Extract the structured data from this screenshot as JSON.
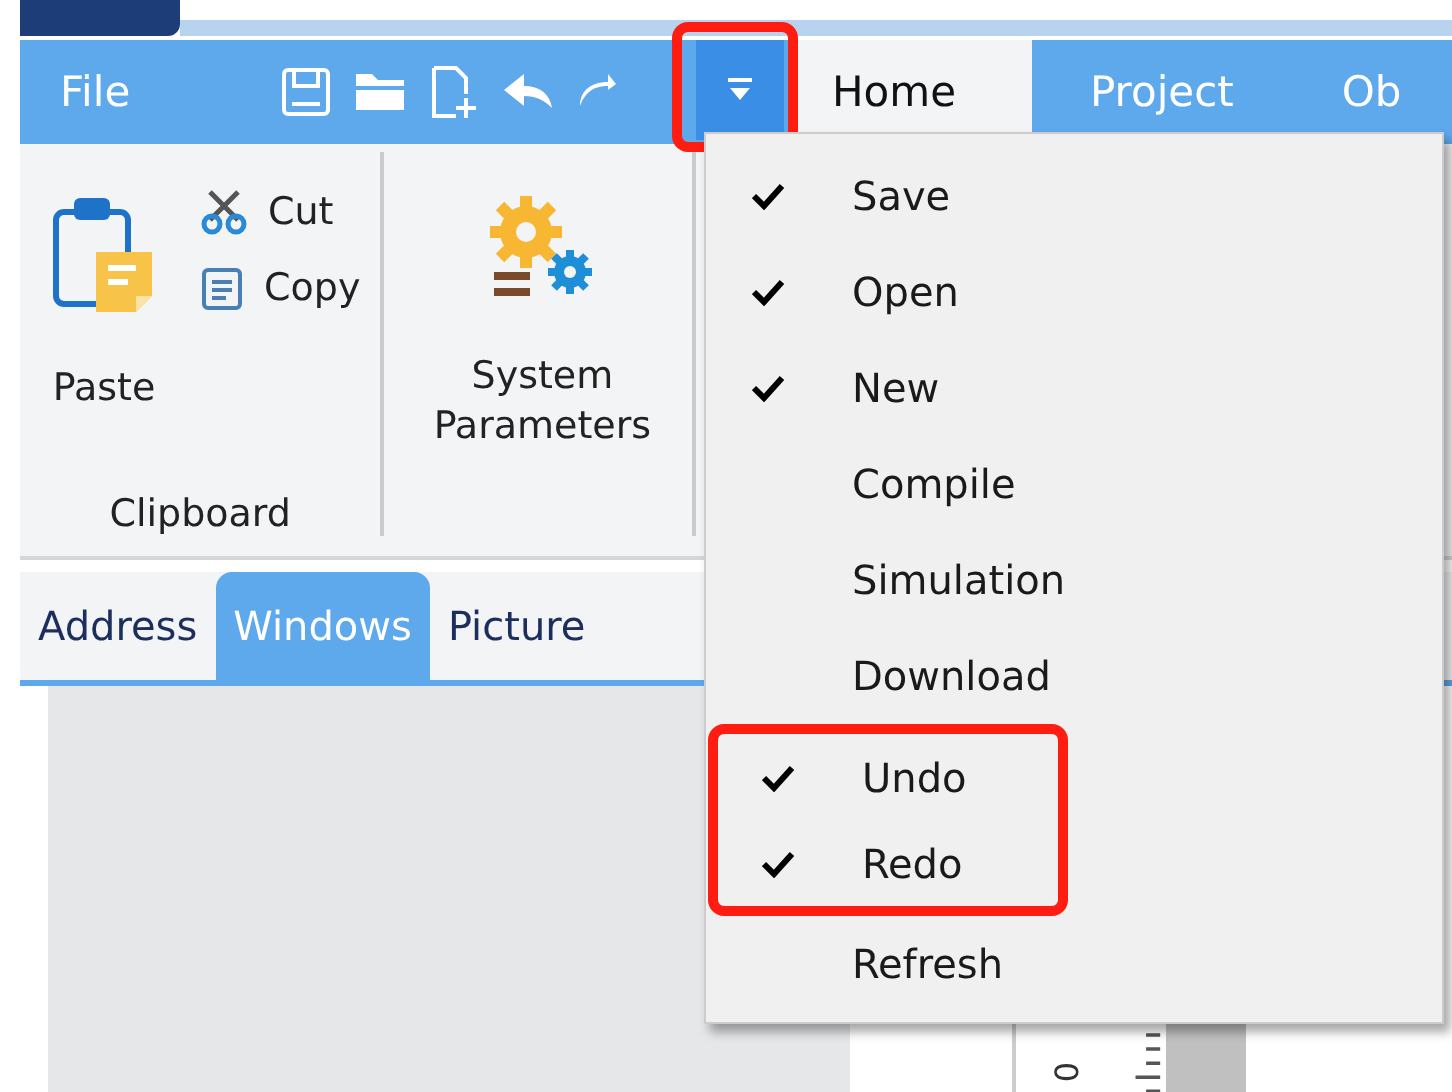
{
  "ribbon": {
    "file_tab": "File",
    "quick_access": [
      {
        "kind": "save"
      },
      {
        "kind": "open"
      },
      {
        "kind": "new"
      },
      {
        "kind": "undo"
      },
      {
        "kind": "redo"
      }
    ],
    "menu_button": {
      "selected": true,
      "highlighted": true
    },
    "tabs": [
      {
        "label": "Home",
        "selected": true
      },
      {
        "label": "Project",
        "selected": false
      },
      {
        "label": "Ob",
        "selected": false
      }
    ],
    "groups": [
      {
        "name": "Clipboard",
        "large": {
          "label": "Paste",
          "kind": "paste"
        },
        "small": [
          {
            "label": "Cut",
            "kind": "cut"
          },
          {
            "label": "Copy",
            "kind": "copy"
          }
        ]
      },
      {
        "large": {
          "label": "System Parameters",
          "kind": "gears"
        }
      }
    ]
  },
  "panel_tabs": [
    {
      "label": "Address",
      "selected": false
    },
    {
      "label": "Windows",
      "selected": true
    },
    {
      "label": "Picture",
      "selected": false
    }
  ],
  "ruler": {
    "label": "0"
  },
  "quick_access_menu": [
    {
      "label": "Save",
      "checked": true,
      "highlighted": false
    },
    {
      "label": "Open",
      "checked": true,
      "highlighted": false
    },
    {
      "label": "New",
      "checked": true,
      "highlighted": false
    },
    {
      "label": "Compile",
      "checked": false,
      "highlighted": false
    },
    {
      "label": "Simulation",
      "checked": false,
      "highlighted": false
    },
    {
      "label": "Download",
      "checked": false,
      "highlighted": false
    },
    {
      "label": "Undo",
      "checked": true,
      "highlighted": true
    },
    {
      "label": "Redo",
      "checked": true,
      "highlighted": true
    },
    {
      "label": "Refresh",
      "checked": false,
      "highlighted": false
    }
  ]
}
